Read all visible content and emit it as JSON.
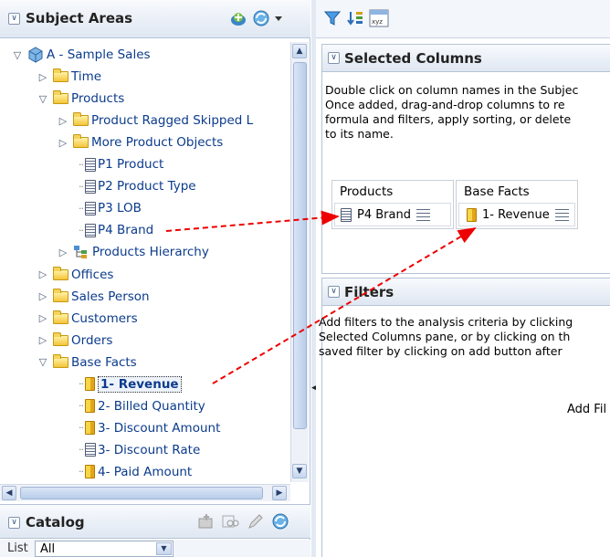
{
  "left_panel": {
    "subject_areas": {
      "title": "Subject Areas",
      "collapse_icon": "collapse-chevron-icon",
      "toolbar_icons": [
        "add-subject-area-icon",
        "refresh-dropdown-icon"
      ]
    },
    "tree": [
      {
        "label": "A - Sample Sales",
        "indent": 0,
        "expander": "▽",
        "icon": "cube-icon",
        "name": "tree-item-a-sample-sales"
      },
      {
        "label": "Time",
        "indent": 1,
        "expander": "▷",
        "icon": "folder-icon",
        "name": "tree-item-time"
      },
      {
        "label": "Products",
        "indent": 1,
        "expander": "▽",
        "icon": "folder-icon",
        "name": "tree-item-products"
      },
      {
        "label": "Product Ragged Skipped L",
        "indent": 2,
        "expander": "▷",
        "icon": "folder-icon",
        "name": "tree-item-product-ragged-skipped"
      },
      {
        "label": "More Product Objects",
        "indent": 2,
        "expander": "▷",
        "icon": "folder-icon",
        "name": "tree-item-more-product-objects"
      },
      {
        "label": "P1 Product",
        "indent": 3,
        "expander": "",
        "icon": "attribute-icon",
        "name": "tree-item-p1-product"
      },
      {
        "label": "P2 Product Type",
        "indent": 3,
        "expander": "",
        "icon": "attribute-icon",
        "name": "tree-item-p2-product-type"
      },
      {
        "label": "P3 LOB",
        "indent": 3,
        "expander": "",
        "icon": "attribute-icon",
        "name": "tree-item-p3-lob"
      },
      {
        "label": "P4 Brand",
        "indent": 3,
        "expander": "",
        "icon": "attribute-icon",
        "name": "tree-item-p4-brand"
      },
      {
        "label": "Products Hierarchy",
        "indent": 2,
        "expander": "▷",
        "icon": "hierarchy-icon",
        "name": "tree-item-products-hierarchy"
      },
      {
        "label": "Offices",
        "indent": 1,
        "expander": "▷",
        "icon": "folder-icon",
        "name": "tree-item-offices"
      },
      {
        "label": "Sales Person",
        "indent": 1,
        "expander": "▷",
        "icon": "folder-icon",
        "name": "tree-item-sales-person"
      },
      {
        "label": "Customers",
        "indent": 1,
        "expander": "▷",
        "icon": "folder-icon",
        "name": "tree-item-customers"
      },
      {
        "label": "Orders",
        "indent": 1,
        "expander": "▷",
        "icon": "folder-icon",
        "name": "tree-item-orders"
      },
      {
        "label": "Base Facts",
        "indent": 1,
        "expander": "▽",
        "icon": "folder-icon",
        "name": "tree-item-base-facts"
      },
      {
        "label": "1- Revenue",
        "indent": 3,
        "expander": "",
        "icon": "measure-icon",
        "name": "tree-item-1-revenue",
        "selected": true
      },
      {
        "label": "2- Billed Quantity",
        "indent": 3,
        "expander": "",
        "icon": "measure-icon",
        "name": "tree-item-2-billed-quantity"
      },
      {
        "label": "3- Discount Amount",
        "indent": 3,
        "expander": "",
        "icon": "measure-icon",
        "name": "tree-item-3-discount-amount"
      },
      {
        "label": "3- Discount Rate",
        "indent": 3,
        "expander": "",
        "icon": "attribute-icon",
        "name": "tree-item-3-discount-rate"
      },
      {
        "label": "4- Paid Amount",
        "indent": 3,
        "expander": "",
        "icon": "measure-icon",
        "name": "tree-item-4-paid-amount"
      }
    ],
    "catalog": {
      "title": "Catalog",
      "toolbar_icons": [
        "new-folder-icon",
        "search-catalog-icon",
        "edit-icon",
        "refresh-icon"
      ],
      "list_label": "List",
      "list_value": "All"
    }
  },
  "right_panel": {
    "toolbar_icons": [
      "filter-icon",
      "sort-icon",
      "xyz-icon"
    ],
    "selected_columns": {
      "title": "Selected Columns",
      "instructions": [
        "Double click on column names in the Subjec",
        "Once added, drag-and-drop columns to re",
        "formula and filters, apply sorting, or delete",
        "to its name."
      ],
      "columns": [
        {
          "folder": "Products",
          "column": "P4 Brand",
          "icon": "attribute-icon"
        },
        {
          "folder": "Base Facts",
          "column": "1- Revenue",
          "icon": "measure-icon"
        }
      ]
    },
    "filters": {
      "title": "Filters",
      "instructions": [
        "Add filters to the analysis criteria by clicking",
        "Selected Columns pane, or by clicking on th",
        "saved filter by clicking on add button after"
      ],
      "add_filter_text": "Add Fil"
    }
  },
  "colors": {
    "header_gradient_top": "#f8fafd",
    "header_gradient_bottom": "#dfe7f2",
    "panel_border": "#b6c3d6",
    "arrow_red": "#ee0000",
    "tree_link_blue": "#0b3b8c"
  }
}
